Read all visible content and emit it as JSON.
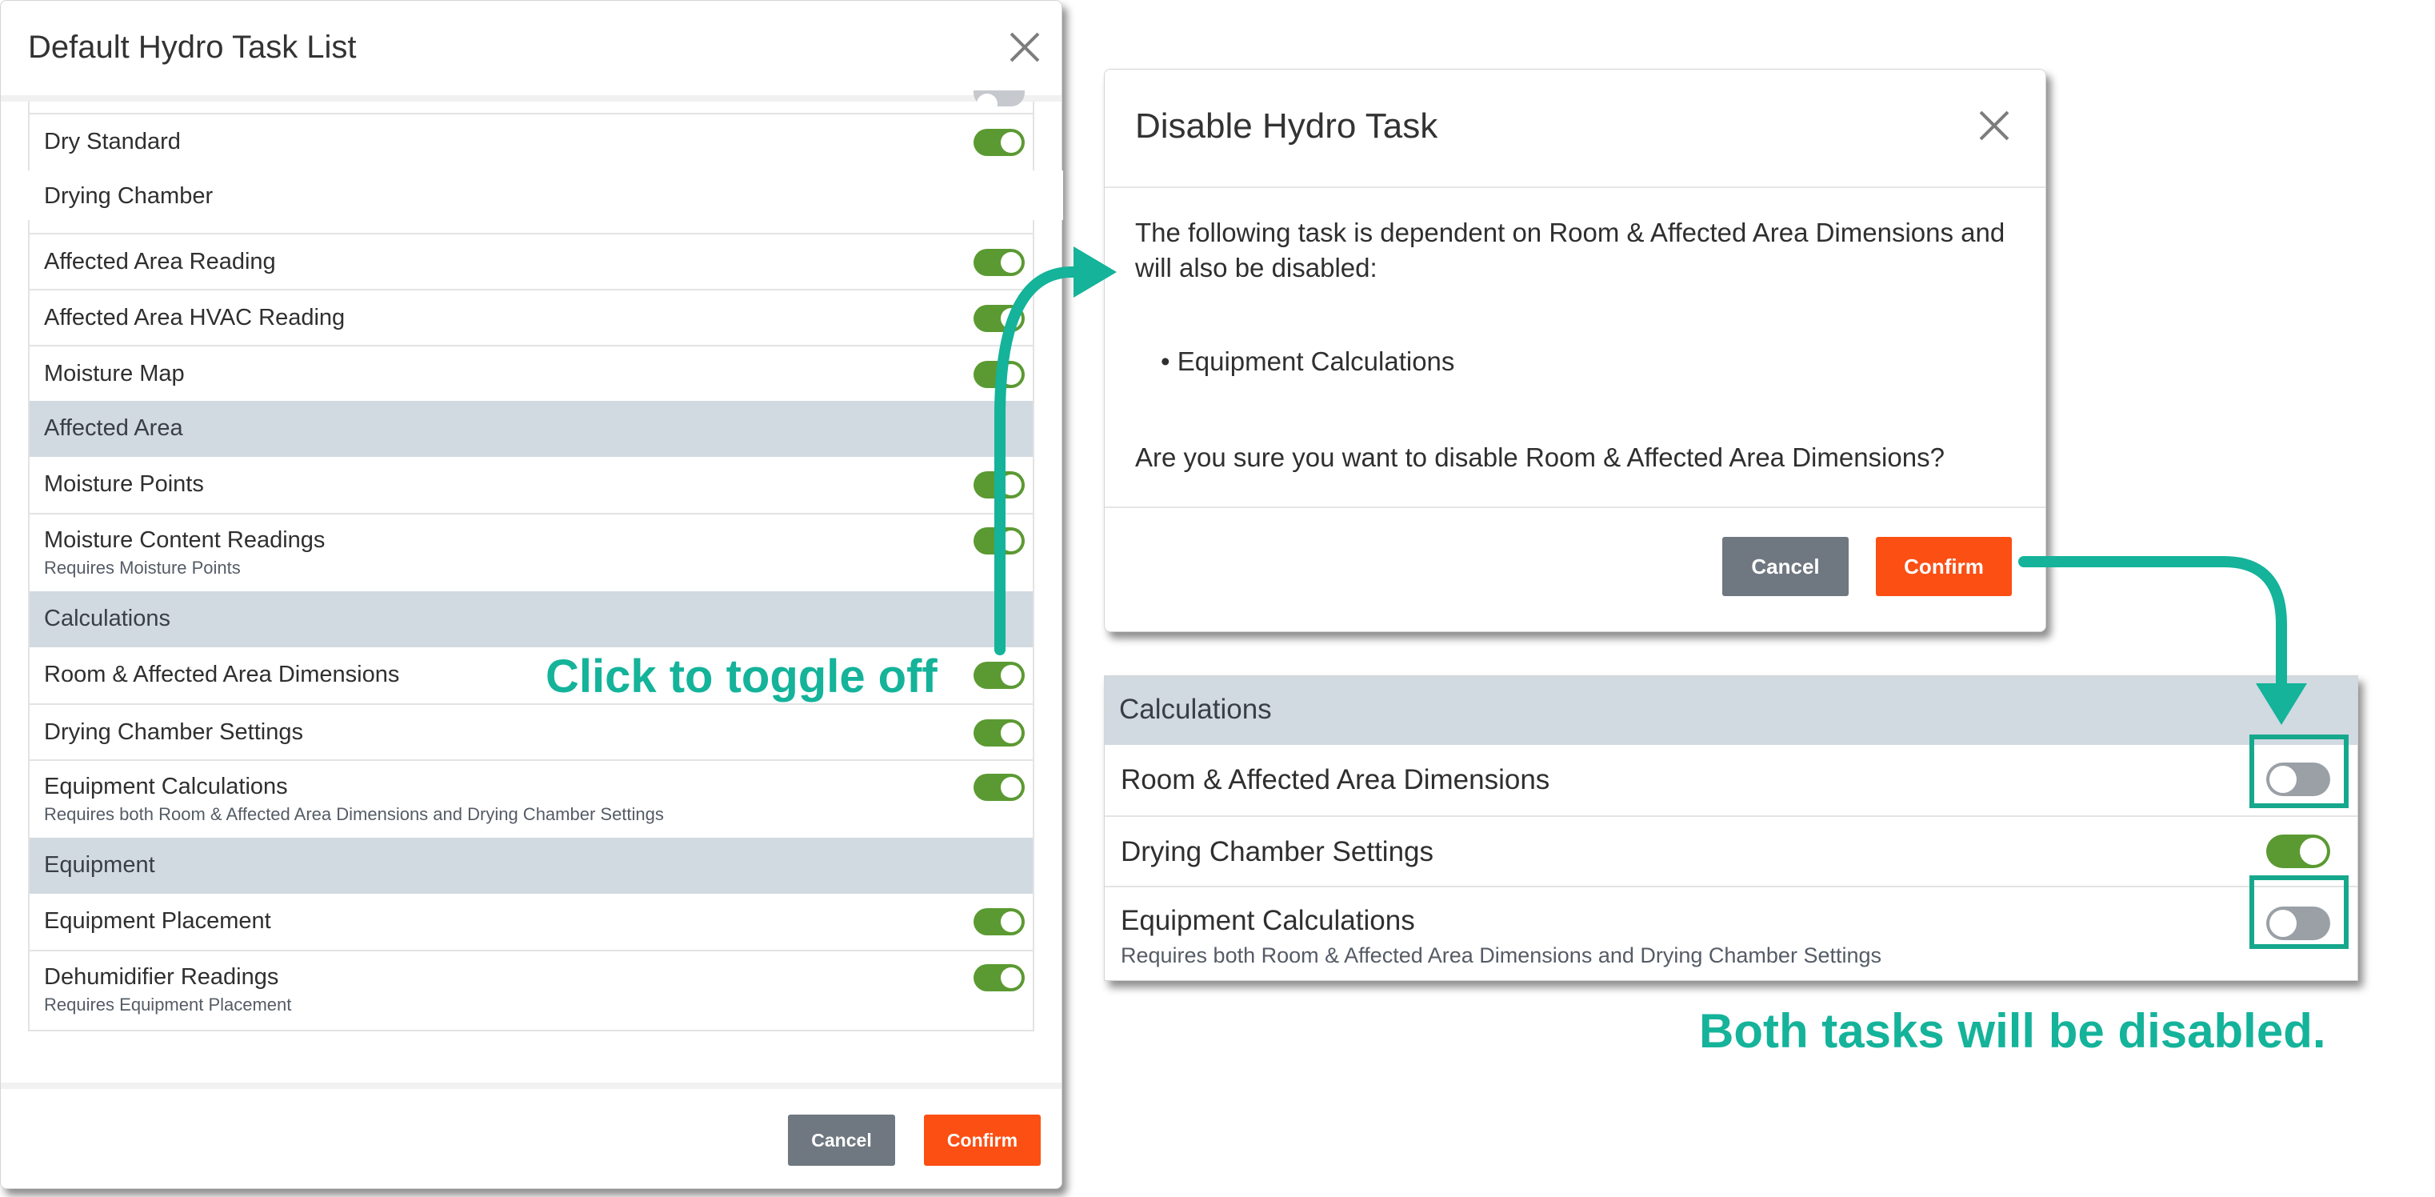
{
  "left_modal": {
    "title": "Default Hydro Task List",
    "rows": [
      {
        "type": "item",
        "label": "Dry Standard",
        "on": true
      },
      {
        "type": "header-plain",
        "label": "Drying Chamber"
      },
      {
        "type": "item",
        "label": "Affected Area Reading",
        "on": true
      },
      {
        "type": "item",
        "label": "Affected Area HVAC Reading",
        "on": true
      },
      {
        "type": "item",
        "label": "Moisture Map",
        "on": true
      },
      {
        "type": "section",
        "label": "Affected Area"
      },
      {
        "type": "item",
        "label": "Moisture Points",
        "on": true
      },
      {
        "type": "item",
        "label": "Moisture Content Readings",
        "sub": "Requires Moisture Points",
        "on": true
      },
      {
        "type": "section",
        "label": "Calculations"
      },
      {
        "type": "item",
        "label": "Room & Affected Area Dimensions",
        "on": true
      },
      {
        "type": "item",
        "label": "Drying Chamber Settings",
        "on": true
      },
      {
        "type": "item",
        "label": "Equipment Calculations",
        "sub": "Requires both Room & Affected Area Dimensions and Drying Chamber Settings",
        "on": true
      },
      {
        "type": "section",
        "label": "Equipment"
      },
      {
        "type": "item",
        "label": "Equipment Placement",
        "on": true
      },
      {
        "type": "item",
        "label": "Dehumidifier Readings",
        "sub": "Requires Equipment Placement",
        "on": true
      }
    ],
    "cancel_label": "Cancel",
    "confirm_label": "Confirm"
  },
  "dialog": {
    "title": "Disable Hydro Task",
    "message": "The following task is dependent on Room & Affected Area Dimensions and will also be disabled:",
    "bullet": "• Equipment Calculations",
    "question": "Are you sure you want to disable Room & Affected Area Dimensions?",
    "cancel_label": "Cancel",
    "confirm_label": "Confirm"
  },
  "result_panel": {
    "section": "Calculations",
    "rows": [
      {
        "label": "Room & Affected Area Dimensions",
        "on": false
      },
      {
        "label": "Drying Chamber Settings",
        "on": true
      },
      {
        "label": "Equipment Calculations",
        "sub": "Requires both Room & Affected Area Dimensions and Drying Chamber Settings",
        "on": false
      }
    ]
  },
  "annotations": {
    "toggle_hint": "Click to toggle off",
    "result_note": "Both tasks will be disabled."
  },
  "colors": {
    "toggle_on": "#5b9a32",
    "toggle_off": "#c6c9cd",
    "section_bg": "#d1d9e1",
    "confirm": "#fb4f14",
    "cancel": "#6f7780",
    "annotation": "#14b39a"
  }
}
